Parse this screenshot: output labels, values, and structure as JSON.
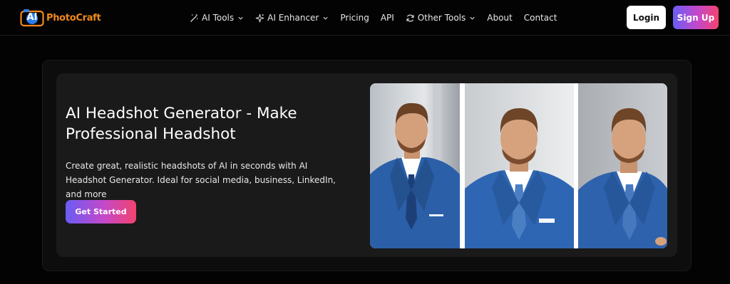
{
  "header": {
    "logo_badge": "AI",
    "logo_text": "PhotoCraft",
    "nav": [
      {
        "label": "AI Tools",
        "icon": "magic-wand-icon",
        "dropdown": true
      },
      {
        "label": "AI Enhancer",
        "icon": "sparkle-icon",
        "dropdown": true
      },
      {
        "label": "Pricing",
        "icon": null,
        "dropdown": false
      },
      {
        "label": "API",
        "icon": null,
        "dropdown": false
      },
      {
        "label": "Other Tools",
        "icon": "refresh-icon",
        "dropdown": true
      },
      {
        "label": "About",
        "icon": null,
        "dropdown": false
      },
      {
        "label": "Contact",
        "icon": null,
        "dropdown": false
      }
    ],
    "login_label": "Login",
    "signup_label": "Sign Up"
  },
  "hero": {
    "title": "AI Headshot Generator - Make Professional Headshot",
    "description": "Create great, realistic headshots of AI in seconds with AI Headshot Generator. Ideal for social media, business, LinkedIn, and more",
    "cta_label": "Get Started"
  },
  "colors": {
    "accent_gradient": [
      "#6a5cf5",
      "#c548c9",
      "#f2436f"
    ],
    "logo_orange": "#f08a1d",
    "logo_blue": "#2f7ef0",
    "background": "#030303",
    "card": "#1a1a1a"
  }
}
